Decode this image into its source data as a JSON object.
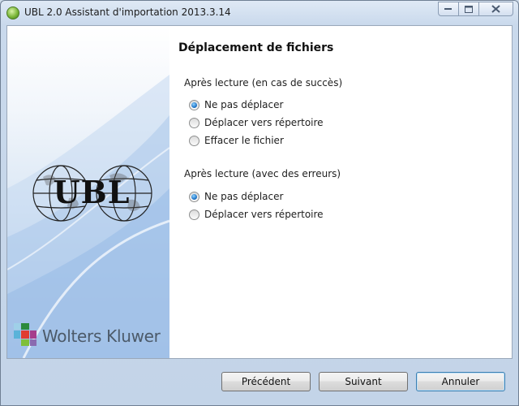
{
  "window": {
    "title": "UBL 2.0 Assistant d'importation 2013.3.14"
  },
  "sidebar": {
    "ubl_logo_text": "UBL",
    "brand_text": "Wolters Kluwer"
  },
  "page": {
    "title": "Déplacement de fichiers",
    "group_success": {
      "label": "Après lecture (en cas de succès)",
      "options": [
        {
          "label": "Ne pas déplacer",
          "selected": true
        },
        {
          "label": "Déplacer vers répertoire",
          "selected": false
        },
        {
          "label": "Effacer le fichier",
          "selected": false
        }
      ]
    },
    "group_errors": {
      "label": "Après lecture (avec des erreurs)",
      "options": [
        {
          "label": "Ne pas déplacer",
          "selected": true
        },
        {
          "label": "Déplacer vers répertoire",
          "selected": false
        }
      ]
    }
  },
  "buttons": {
    "previous": "Précédent",
    "next": "Suivant",
    "cancel": "Annuler"
  },
  "icons": {
    "app": "app-icon",
    "minimize": "minimize-icon",
    "maximize": "maximize-icon",
    "close": "close-icon"
  }
}
